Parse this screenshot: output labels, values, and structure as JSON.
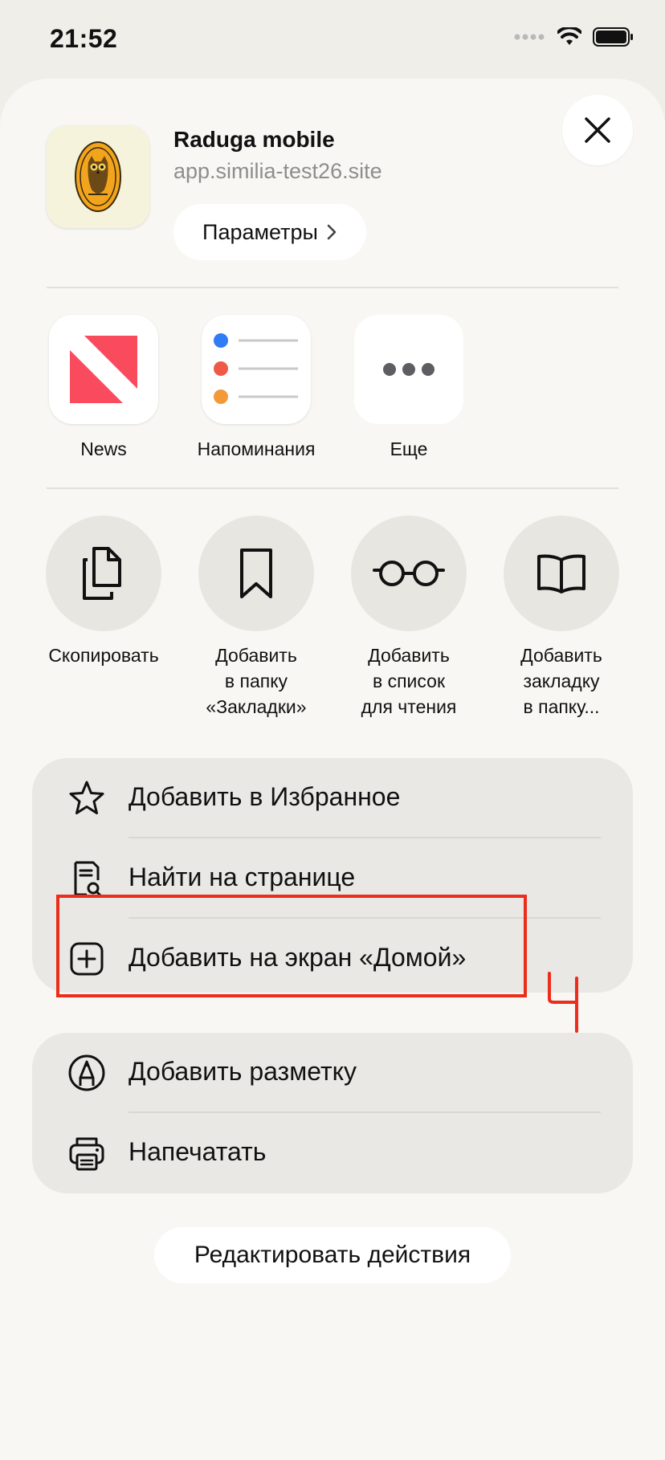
{
  "status_bar": {
    "time": "21:52"
  },
  "site": {
    "title": "Raduga mobile",
    "url": "app.similia-test26.site",
    "params_label": "Параметры",
    "params_chevron": "›"
  },
  "share_apps": [
    {
      "label": "News",
      "icon": "news-icon"
    },
    {
      "label": "Напоминания",
      "icon": "reminders-icon"
    },
    {
      "label": "Еще",
      "icon": "more-icon"
    }
  ],
  "actions": [
    {
      "label": "Скопировать",
      "icon": "copy-icon"
    },
    {
      "label_lines": [
        "Добавить",
        "в папку",
        "«Закладки»"
      ],
      "icon": "bookmark-icon"
    },
    {
      "label_lines": [
        "Добавить",
        "в список",
        "для чтения"
      ],
      "icon": "glasses-icon"
    },
    {
      "label_lines": [
        "Добавить",
        "закладку",
        "в папку..."
      ],
      "icon": "book-icon"
    }
  ],
  "menu_group_1": [
    {
      "label": "Добавить в Избранное",
      "icon": "star-icon"
    },
    {
      "label": "Найти на странице",
      "icon": "find-page-icon"
    },
    {
      "label": "Добавить на экран «Домой»",
      "icon": "add-square-icon"
    }
  ],
  "menu_group_2": [
    {
      "label": "Добавить разметку",
      "icon": "markup-icon"
    },
    {
      "label": "Напечатать",
      "icon": "printer-icon"
    }
  ],
  "edit_actions_label": "Редактировать действия",
  "annotation_mark": "4",
  "colors": {
    "highlight": "#ec2d1b",
    "accent_blue": "#2f7cf6"
  }
}
